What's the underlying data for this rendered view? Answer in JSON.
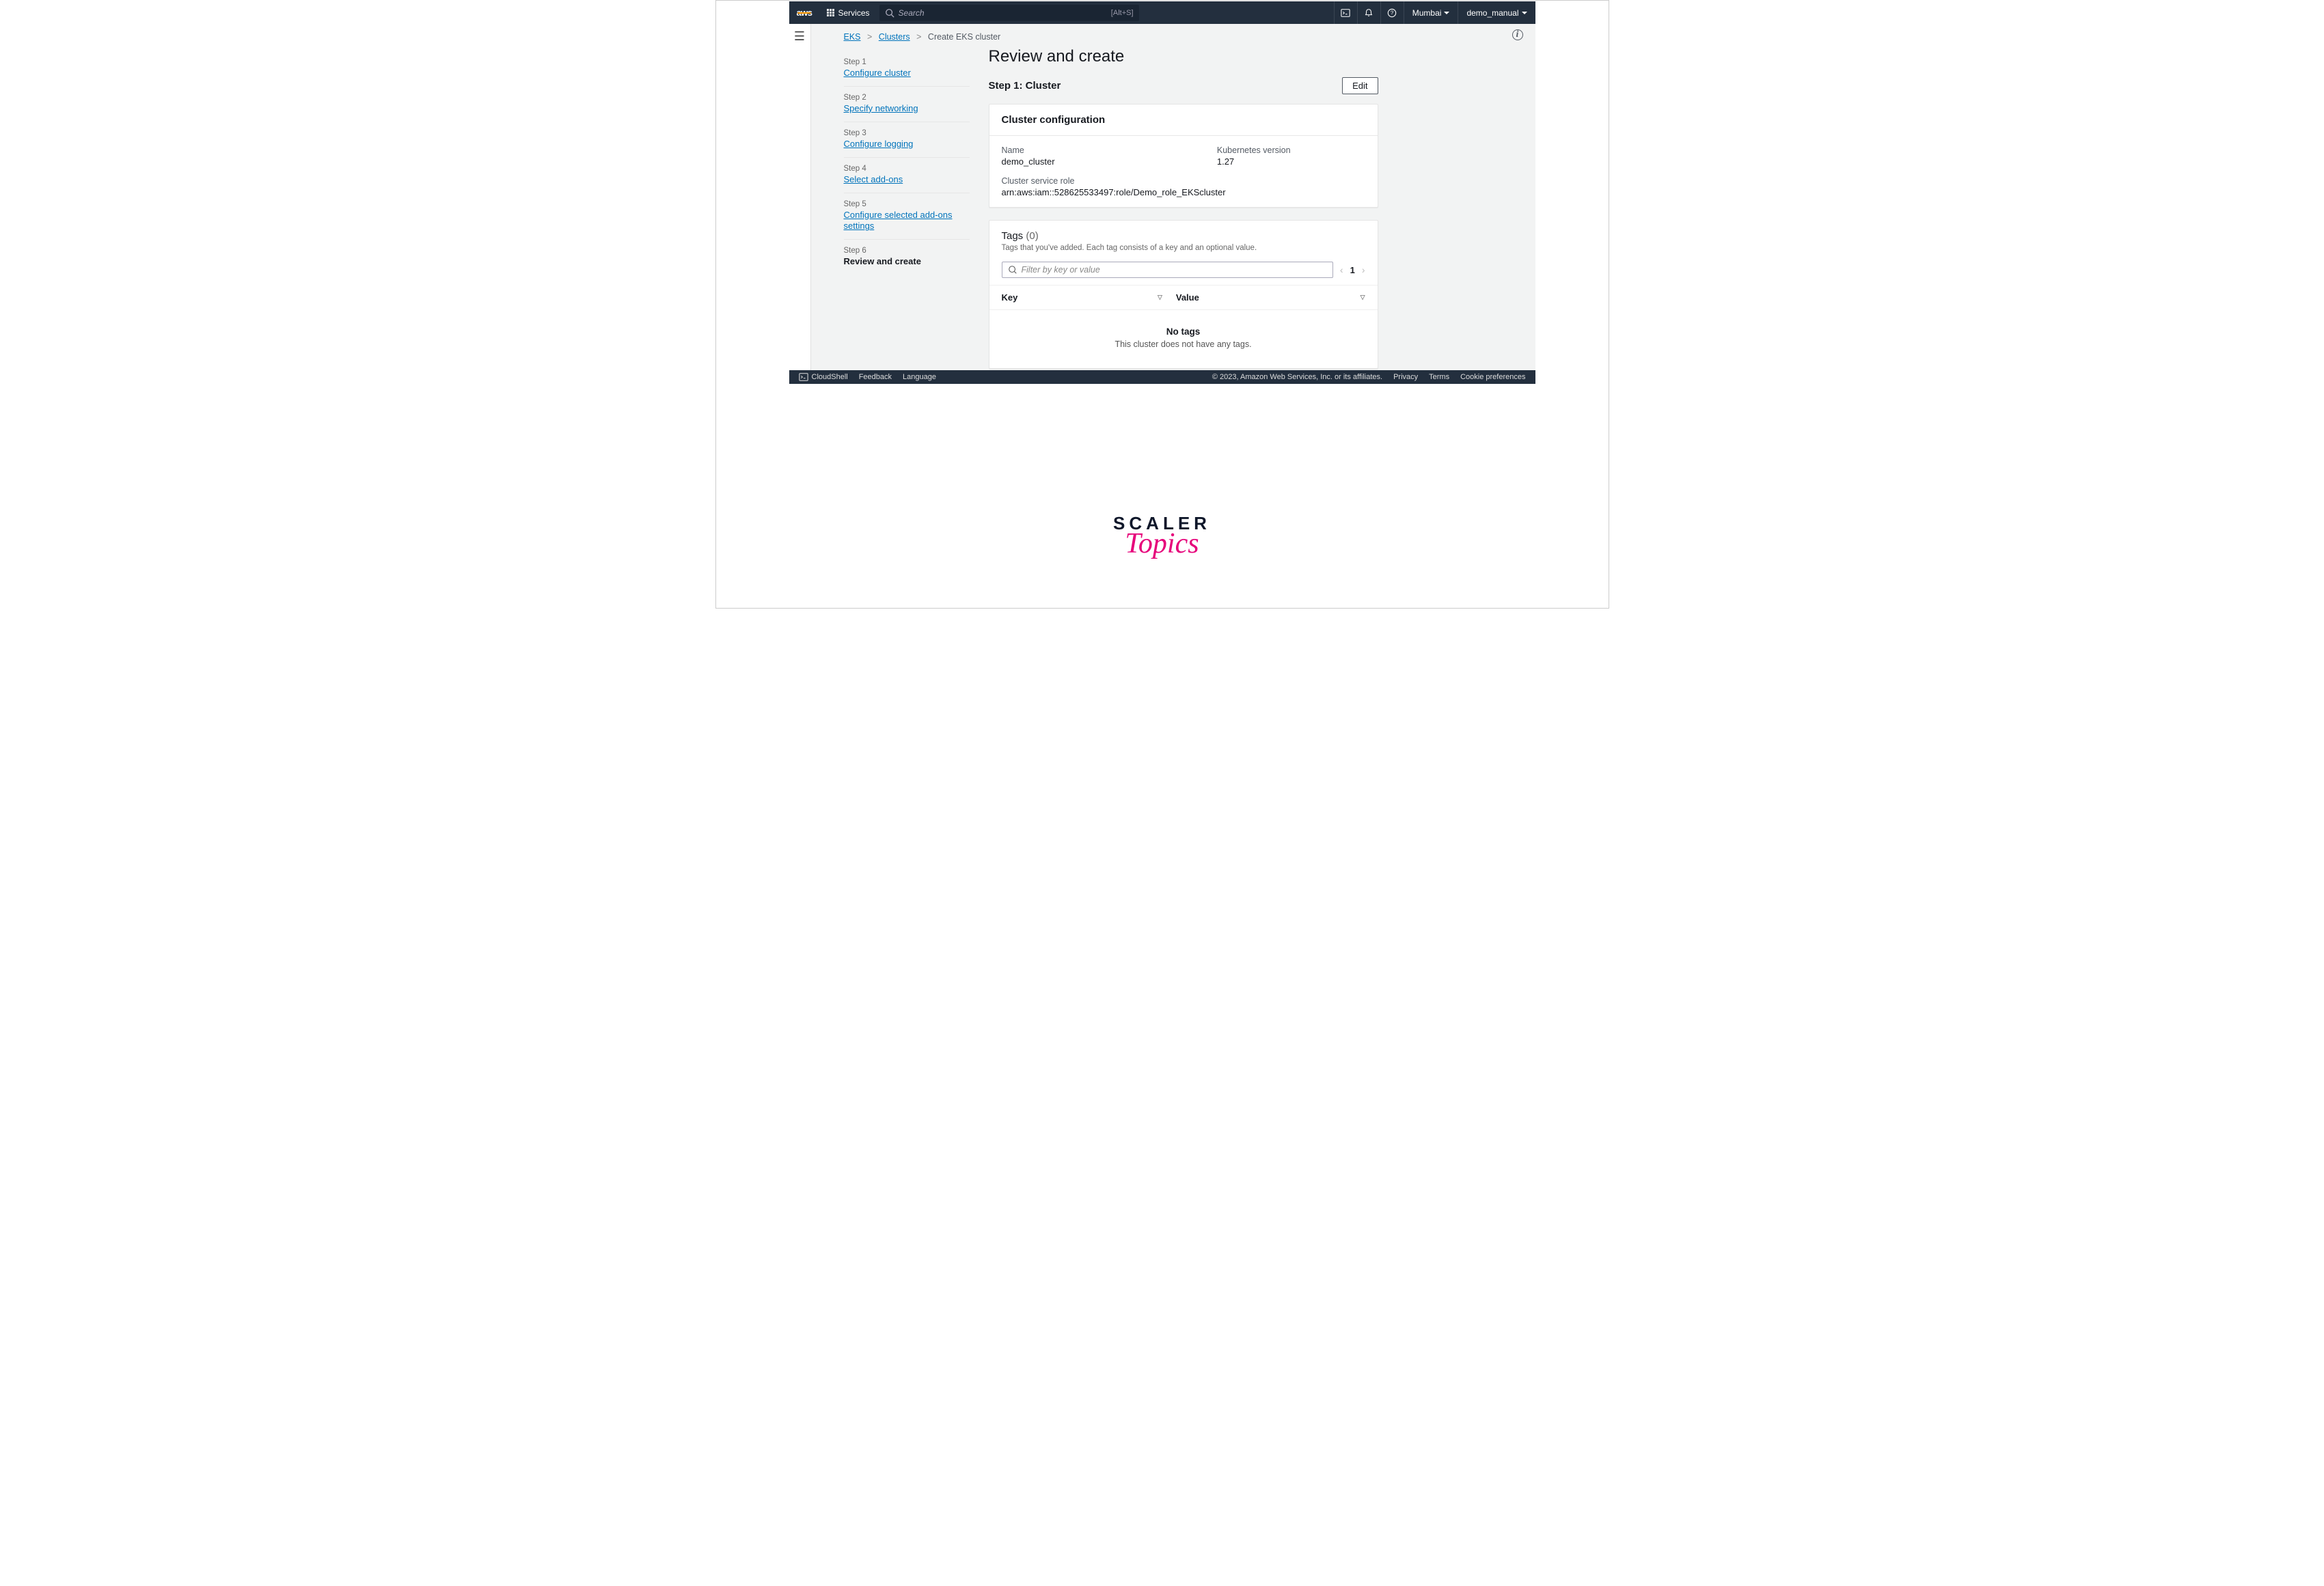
{
  "topnav": {
    "services": "Services",
    "search_placeholder": "Search",
    "search_kbd": "[Alt+S]",
    "region": "Mumbai",
    "user": "demo_manual"
  },
  "breadcrumb": {
    "eks": "EKS",
    "clusters": "Clusters",
    "create": "Create EKS cluster"
  },
  "stepper": [
    {
      "label": "Step 1",
      "link": "Configure cluster"
    },
    {
      "label": "Step 2",
      "link": "Specify networking"
    },
    {
      "label": "Step 3",
      "link": "Configure logging"
    },
    {
      "label": "Step 4",
      "link": "Select add-ons"
    },
    {
      "label": "Step 5",
      "link": "Configure selected add-ons settings"
    },
    {
      "label": "Step 6",
      "current": "Review and create"
    }
  ],
  "page": {
    "title": "Review and create",
    "section_title": "Step 1: Cluster",
    "edit": "Edit"
  },
  "cluster_config": {
    "header": "Cluster configuration",
    "name_label": "Name",
    "name_value": "demo_cluster",
    "k8s_label": "Kubernetes version",
    "k8s_value": "1.27",
    "role_label": "Cluster service role",
    "role_value": "arn:aws:iam::528625533497:role/Demo_role_EKScluster"
  },
  "tags": {
    "title": "Tags",
    "count": "(0)",
    "desc": "Tags that you've added. Each tag consists of a key and an optional value.",
    "filter_placeholder": "Filter by key or value",
    "page_current": "1",
    "th_key": "Key",
    "th_value": "Value",
    "empty_title": "No tags",
    "empty_text": "This cluster does not have any tags."
  },
  "footer": {
    "cloudshell": "CloudShell",
    "feedback": "Feedback",
    "language": "Language",
    "copyright": "© 2023, Amazon Web Services, Inc. or its affiliates.",
    "privacy": "Privacy",
    "terms": "Terms",
    "cookies": "Cookie preferences"
  },
  "watermark": {
    "top": "SCALER",
    "bottom": "Topics"
  }
}
